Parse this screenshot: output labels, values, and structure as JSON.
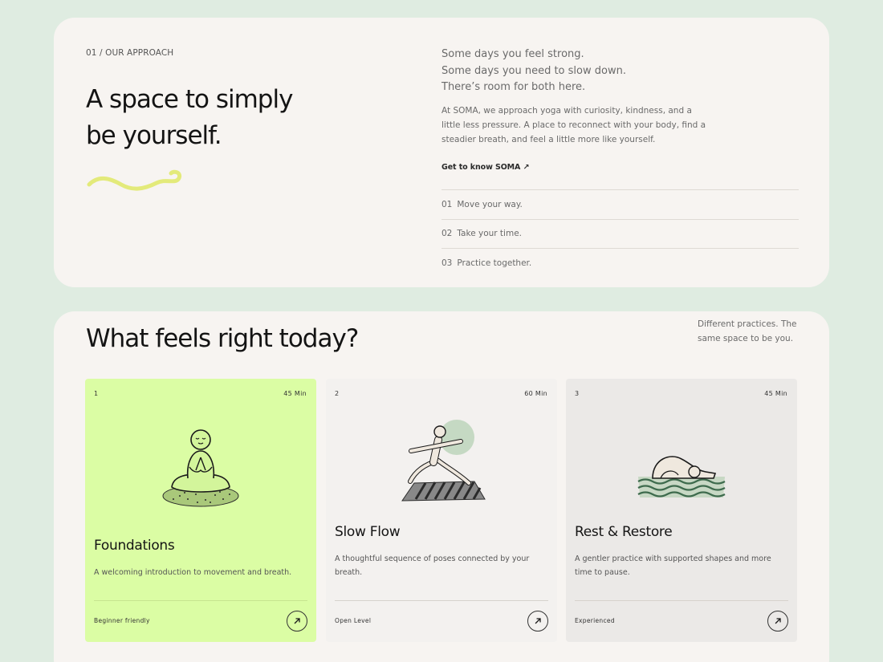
{
  "approach": {
    "eyebrow": "01 / OUR APPROACH",
    "title_line1": "A space to simply",
    "title_line2": "be yourself.",
    "lead": [
      "Some days you feel strong.",
      "Some days you need to slow down.",
      "There’s room for both here."
    ],
    "body": "At SOMA, we approach yoga with curiosity, kindness, and a little less pressure. A place to reconnect with your body, find a steadier breath, and feel a little more like yourself.",
    "link_label": "Get to know SOMA ↗",
    "principles": [
      {
        "num": "01",
        "label": "Move your way."
      },
      {
        "num": "02",
        "label": "Take your time."
      },
      {
        "num": "03",
        "label": "Practice together."
      }
    ]
  },
  "practices": {
    "title": "What feels right today?",
    "aside": "Different practices. The same space to be you.",
    "cards": [
      {
        "index": "1",
        "duration": "45 Min",
        "title": "Foundations",
        "description": "A welcoming introduction to movement and breath.",
        "level": "Beginner friendly",
        "icon": "meditation-icon"
      },
      {
        "index": "2",
        "duration": "60 Min",
        "title": "Slow Flow",
        "description": "A thoughtful sequence of poses connected by your breath.",
        "level": "Open Level",
        "icon": "warrior-pose-icon"
      },
      {
        "index": "3",
        "duration": "45 Min",
        "title": "Rest & Restore",
        "description": "A gentler practice with supported shapes and more time to pause.",
        "level": "Experienced",
        "icon": "childs-pose-icon"
      }
    ]
  },
  "colors": {
    "background": "#dfece1",
    "panel": "#f7f4f1",
    "accent_lime": "#dbfda4",
    "squiggle": "#e3ea7a"
  }
}
